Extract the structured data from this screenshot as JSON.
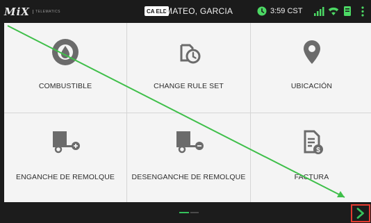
{
  "status_bar": {
    "brand": "MiX",
    "brand_sub": "TELEMATICS",
    "eld_badge": "CA ELD",
    "driver_name": "MATEO, GARCIA",
    "time": "3:59 CST"
  },
  "tiles": [
    {
      "label": "COMBUSTIBLE",
      "icon": "fuel-icon"
    },
    {
      "label": "CHANGE RULE SET",
      "icon": "rule-set-clock-icon"
    },
    {
      "label": "UBICACIÓN",
      "icon": "location-pin-icon"
    },
    {
      "label": "ENGANCHE DE REMOLQUE",
      "icon": "trailer-hook-icon"
    },
    {
      "label": "DESENGANCHE DE REMOLQUE",
      "icon": "trailer-unhook-icon"
    },
    {
      "label": "FACTURA",
      "icon": "invoice-icon"
    }
  ],
  "pager": {
    "pages": 2,
    "current": 1
  },
  "colors": {
    "accent_green": "#35c25c",
    "icon_gray": "#6b6b6b",
    "highlight_red": "#e53a30",
    "status_green": "#4cd964"
  }
}
